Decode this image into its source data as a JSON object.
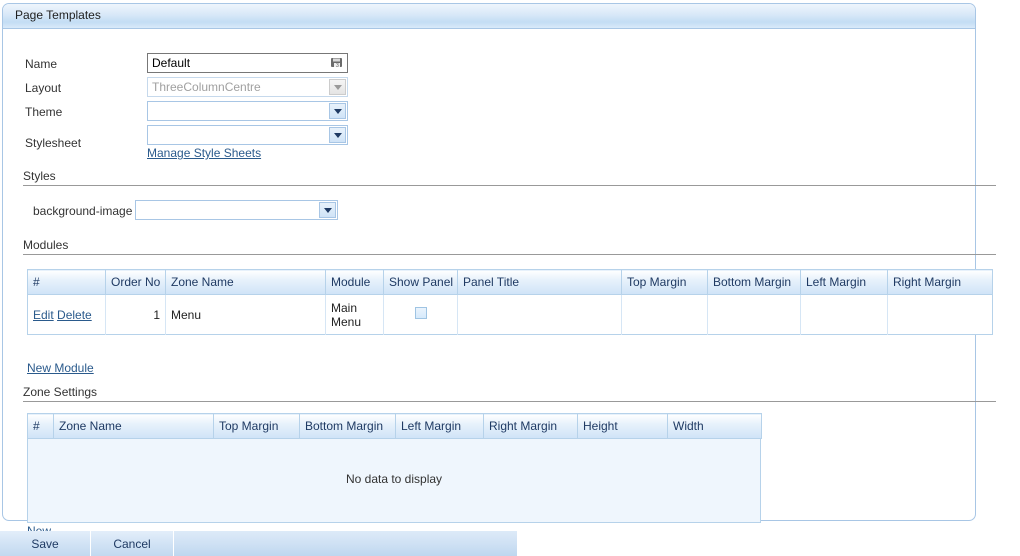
{
  "window": {
    "title": "Page Templates"
  },
  "form": {
    "fields": [
      {
        "label": "Name",
        "value": "Default",
        "placeholder": "",
        "type": "text",
        "icon": "disk-icon"
      },
      {
        "label": "Layout",
        "value": "ThreeColumnCentre",
        "placeholder": "",
        "type": "select-disabled",
        "icon": "chevron-down-icon"
      },
      {
        "label": "Theme",
        "value": "",
        "placeholder": "",
        "type": "select",
        "icon": "chevron-down-icon"
      },
      {
        "label": "Stylesheet",
        "value": "",
        "placeholder": "",
        "type": "select",
        "icon": "chevron-down-icon"
      }
    ],
    "manage_stylesheets_link": "Manage Style Sheets"
  },
  "styles_section": {
    "title": "Styles",
    "property_label": "background-image",
    "property_value": "",
    "icon": "chevron-down-icon"
  },
  "modules_section": {
    "title": "Modules",
    "columns": [
      "#",
      "Order No",
      "Zone Name",
      "Module",
      "Show Panel",
      "Panel Title",
      "Top Margin",
      "Bottom Margin",
      "Left Margin",
      "Right Margin"
    ],
    "rows": [
      {
        "actions": [
          "Edit",
          "Delete"
        ],
        "order_no": "1",
        "zone_name": "Menu",
        "module": "Main Menu",
        "show_panel": false,
        "panel_title": "",
        "top_margin": "",
        "bottom_margin": "",
        "left_margin": "",
        "right_margin": ""
      }
    ],
    "new_link": "New Module"
  },
  "zone_settings_section": {
    "title": "Zone Settings",
    "columns": [
      "#",
      "Zone Name",
      "Top Margin",
      "Bottom Margin",
      "Left Margin",
      "Right Margin",
      "Height",
      "Width"
    ],
    "empty_message": "No data to display",
    "new_link": "New"
  },
  "footer": {
    "save_label": "Save",
    "cancel_label": "Cancel"
  },
  "colors": {
    "accent": "#a8c6e5",
    "header_gradient_top": "#eef5fc",
    "header_gradient_bottom": "#c3ddf4",
    "link": "#2a5a8c",
    "grid_border": "#b6d2ea",
    "empty_bg": "#eff6fd"
  }
}
